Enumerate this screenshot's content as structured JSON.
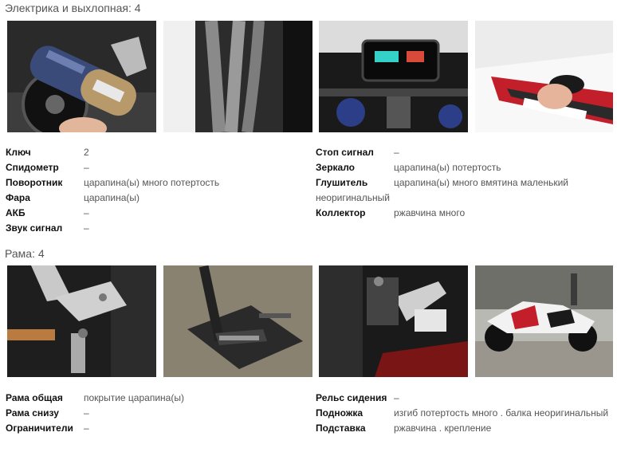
{
  "section1": {
    "title": "Электрика и выхлопная: 4",
    "photos": [
      "exhaust-muffler-photo",
      "exhaust-headers-photo",
      "dashboard-photo",
      "turn-signal-photo"
    ],
    "left": [
      {
        "label": "Ключ",
        "value": "2"
      },
      {
        "label": "Спидометр",
        "value": "–"
      },
      {
        "label": "Поворотник",
        "value": "царапина(ы) много потертость"
      },
      {
        "label": "Фара",
        "value": "царапина(ы)"
      },
      {
        "label": "АКБ",
        "value": "–"
      },
      {
        "label": "Звук сигнал",
        "value": "–"
      }
    ],
    "right": [
      {
        "label": "Стоп сигнал",
        "value": "–"
      },
      {
        "label": "Зеркало",
        "value": "царапина(ы) потертость"
      },
      {
        "label": "Глушитель",
        "value": "царапина(ы) много вмятина маленький"
      },
      {
        "label": "",
        "value": "неоригинальный"
      },
      {
        "label": "Коллектор",
        "value": "ржавчина много"
      }
    ]
  },
  "section2": {
    "title": "Рама: 4",
    "photos": [
      "footpeg-bracket-photo",
      "kickstand-plate-photo",
      "frame-side-photo",
      "motorcycle-full-photo"
    ],
    "left": [
      {
        "label": "Рама общая",
        "value": "покрытие царапина(ы)"
      },
      {
        "label": "Рама снизу",
        "value": "–"
      },
      {
        "label": "Ограничители",
        "value": "–"
      }
    ],
    "right": [
      {
        "label": "Рельс сидения",
        "value": "–"
      },
      {
        "label": "Подножка",
        "value": "изгиб потертость много . балка неоригинальный"
      },
      {
        "label": "Подставка",
        "value": "ржавчина . крепление"
      }
    ]
  }
}
